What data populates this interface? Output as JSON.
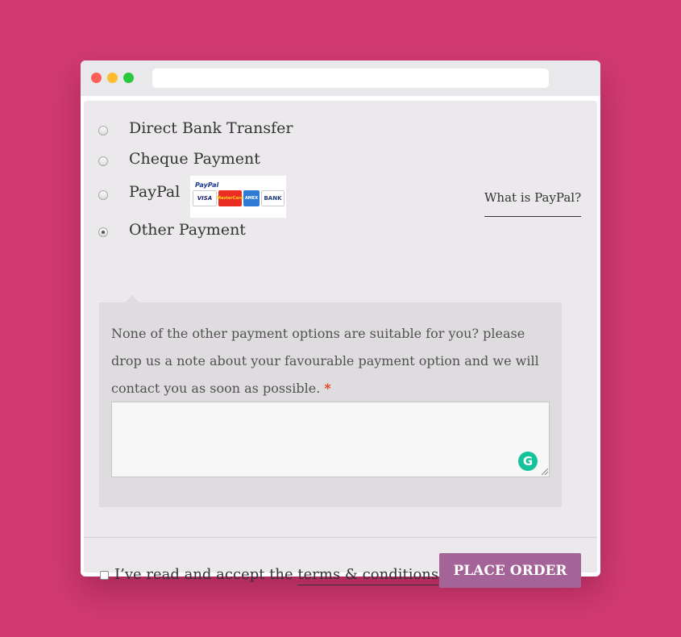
{
  "window": {
    "url": ""
  },
  "payment_methods": [
    {
      "label": "Direct Bank Transfer",
      "selected": false
    },
    {
      "label": "Cheque Payment",
      "selected": false
    },
    {
      "label": "PayPal",
      "selected": false
    },
    {
      "label": "Other Payment",
      "selected": true
    }
  ],
  "paypal": {
    "logo_text": "PayPal",
    "cards": [
      "VISA",
      "MasterCard",
      "AMEX",
      "BANK"
    ],
    "what_is_link": "What is PayPal?"
  },
  "other_payment": {
    "description": "None of the other payment options are suitable for you? please drop us a note about your favourable payment option and we will contact you as soon as possible.",
    "required_marker": "*",
    "note_value": "",
    "grammarly_glyph": "G"
  },
  "terms": {
    "prefix": "I’ve read and accept the",
    "link_text": "terms & conditions",
    "checked": false
  },
  "place_order": {
    "label": "Place order"
  },
  "colors": {
    "background": "#d13a71",
    "button": "#a46497",
    "required": "#e2401c",
    "grammarly": "#15c39a"
  }
}
